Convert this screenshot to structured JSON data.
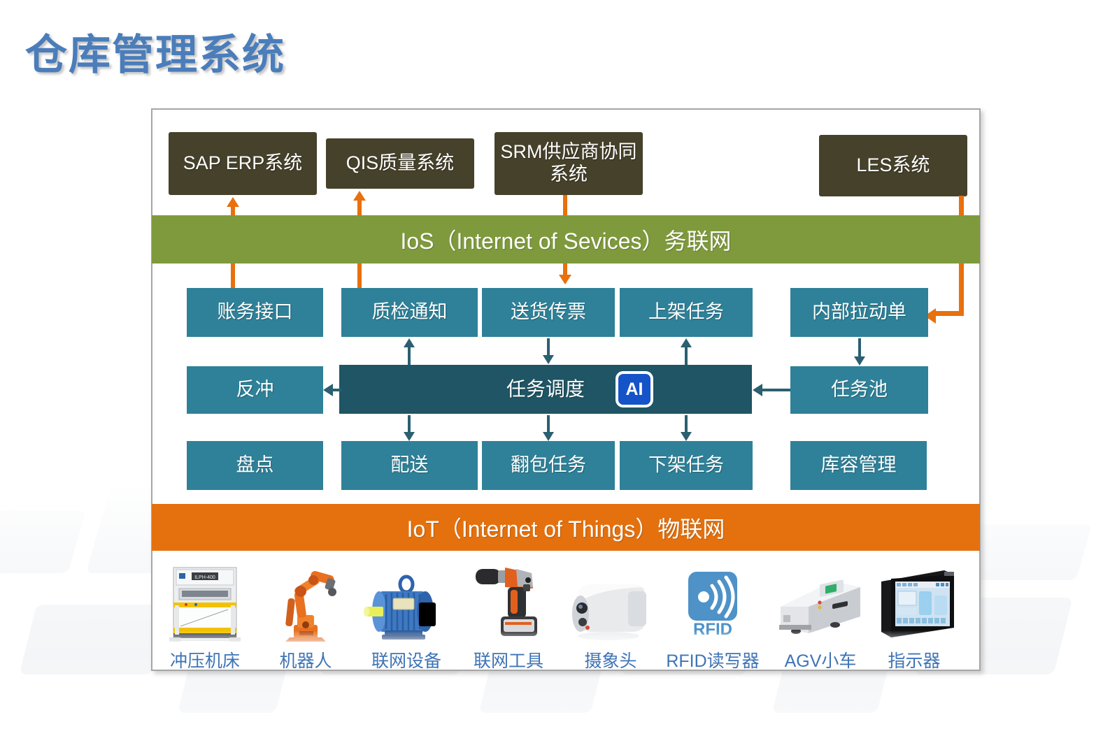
{
  "page": {
    "title": "仓库管理系统"
  },
  "external_systems": [
    {
      "label": "SAP ERP系统",
      "id": "sap-erp"
    },
    {
      "label": "QIS质量系统",
      "id": "qis"
    },
    {
      "label": "SRM供应商协同系统",
      "id": "srm"
    },
    {
      "label": "LES系统",
      "id": "les"
    }
  ],
  "bands": {
    "ios": "IoS（Internet of Sevices）务联网",
    "iot": "IoT（Internet of Things）物联网"
  },
  "service_row_1": [
    {
      "label": "账务接口"
    },
    {
      "label": "质检通知"
    },
    {
      "label": "送货传票"
    },
    {
      "label": "上架任务"
    },
    {
      "label": "内部拉动单"
    }
  ],
  "service_row_2": {
    "left": {
      "label": "反冲"
    },
    "center": {
      "label": "任务调度",
      "badge": "AI"
    },
    "right": {
      "label": "任务池"
    }
  },
  "service_row_3": [
    {
      "label": "盘点"
    },
    {
      "label": "配送"
    },
    {
      "label": "翻包任务"
    },
    {
      "label": "下架任务"
    },
    {
      "label": "库容管理"
    }
  ],
  "devices": [
    {
      "label": "冲压机床",
      "icon": "stamping-press-icon"
    },
    {
      "label": "机器人",
      "icon": "robot-arm-icon"
    },
    {
      "label": "联网设备",
      "icon": "motor-icon"
    },
    {
      "label": "联网工具",
      "icon": "power-tool-icon"
    },
    {
      "label": "摄象头",
      "icon": "camera-icon"
    },
    {
      "label": "RFID读写器",
      "icon": "rfid-icon"
    },
    {
      "label": "AGV小车",
      "icon": "agv-cart-icon"
    },
    {
      "label": "指示器",
      "icon": "hmi-panel-icon"
    }
  ],
  "colors": {
    "title": "#4a7dba",
    "external_box": "#46412a",
    "service_box": "#2e8198",
    "scheduler": "#1f5564",
    "band_ios": "#7f9a3c",
    "band_iot": "#e4710e",
    "orange_arrow": "#e8700d",
    "teal_arrow": "#2a6070",
    "ai_badge": "#1553c8"
  },
  "rfid_icon_text": "RFID"
}
